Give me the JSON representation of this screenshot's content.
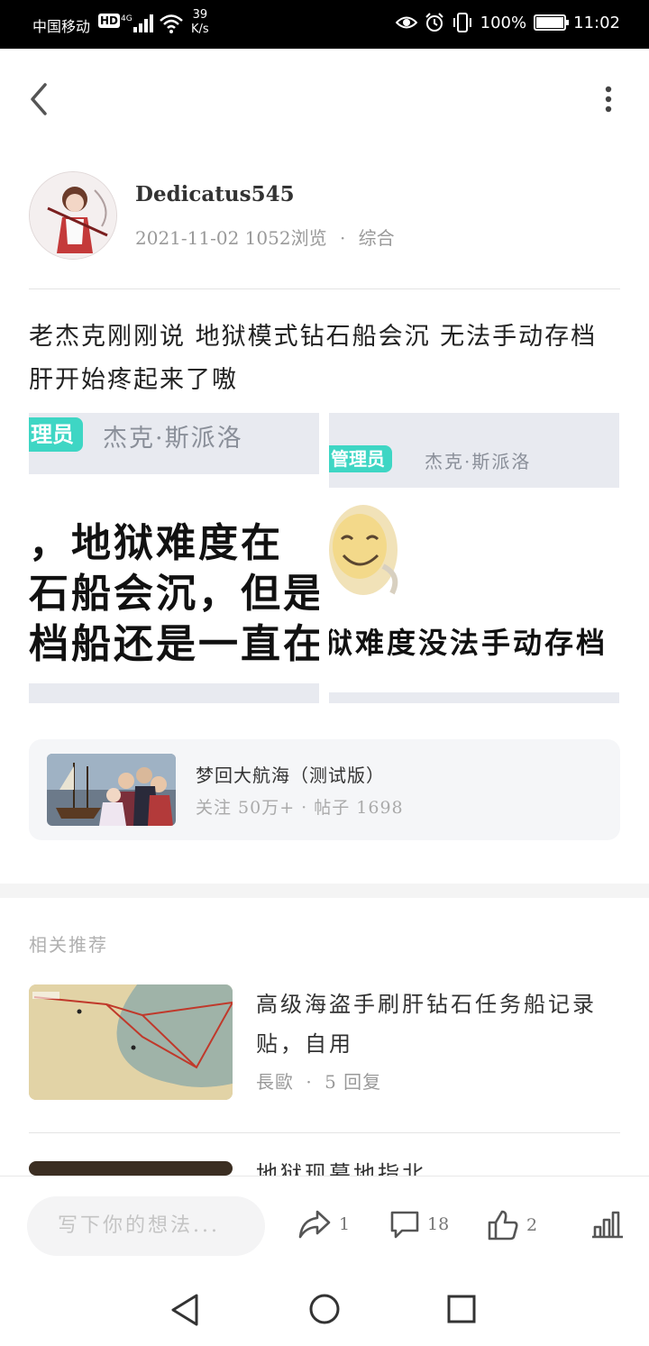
{
  "status_bar": {
    "carrier": "中国移动",
    "hd": "HD",
    "network": "4G",
    "speed_value": "39",
    "speed_unit": "K/s",
    "battery": "100%",
    "time": "11:02"
  },
  "author": {
    "name": "Dedicatus545",
    "date": "2021-11-02",
    "views": "1052浏览",
    "dot": "·",
    "category": "综合"
  },
  "post": {
    "text": "老杰克刚刚说 地狱模式钻石船会沉 无法手动存档 肝开始疼起来了嗷",
    "images": [
      {
        "badge": "理员",
        "name": "杰克·斯派洛",
        "lines": [
          "，地狱难度在",
          "石船会沉，但是",
          "档船还是一直在"
        ]
      },
      {
        "badge": "管理员",
        "name": "杰克·斯派洛",
        "line": "狱难度没法手动存档"
      }
    ]
  },
  "game_card": {
    "name": "梦回大航海（测试版）",
    "stats": "关注 50万+ · 帖子 1698"
  },
  "recommend": {
    "title": "相关推荐",
    "items": [
      {
        "title": "高级海盗手刷肝钻石任务船记录贴，自用",
        "author": "長歐",
        "dot": "·",
        "replies": "5 回复"
      },
      {
        "title": "地狱现墓地指北..."
      }
    ]
  },
  "bottom_bar": {
    "placeholder": "写下你的想法...",
    "shares": "1",
    "comments": "18",
    "likes": "2"
  },
  "colors": {
    "badge": "#3ed6c4",
    "status_bar": "#000000",
    "card_bg": "#f5f6f8"
  },
  "icons": [
    "back-icon",
    "more-icon",
    "share-icon",
    "comment-icon",
    "like-icon",
    "stats-icon",
    "nav-back-icon",
    "nav-home-icon",
    "nav-recent-icon"
  ]
}
